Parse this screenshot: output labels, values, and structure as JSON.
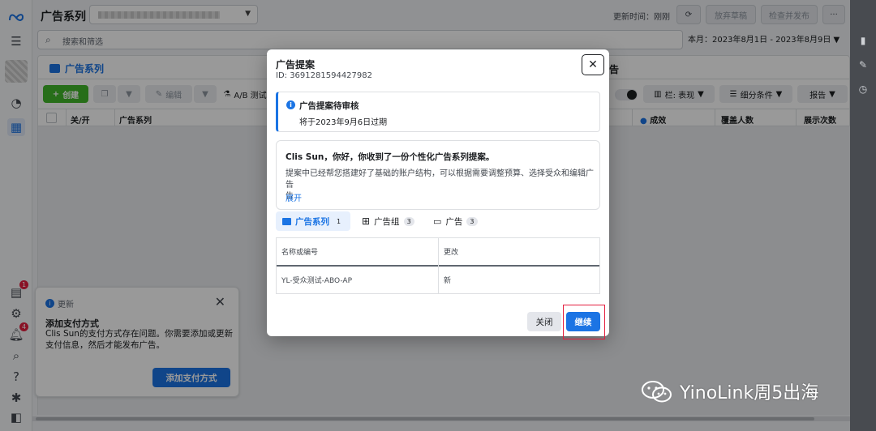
{
  "topbar": {
    "title": "广告系列",
    "updated": "更新时间：刚刚",
    "discard": "放弃草稿",
    "review_publish": "检查并发布",
    "more": "···"
  },
  "search": {
    "placeholder": "搜索和筛选"
  },
  "date_range": "本月：2023年8月1日 - 2023年8月9日",
  "tabs": {
    "campaigns": "广告系列",
    "ads_partial": "告"
  },
  "toolbar": {
    "create": "创建",
    "edit": "编辑",
    "ab_test": "A/B 测试",
    "columns": "栏: 表现",
    "breakdown": "细分条件",
    "reports": "报告"
  },
  "table": {
    "headers": [
      "关/开",
      "广告系列",
      "成效",
      "覆盖人数",
      "展示次数"
    ]
  },
  "rail": {
    "badge_campaigns": "1",
    "badge_notifications": "4"
  },
  "update_card": {
    "label": "更新",
    "title": "添加支付方式",
    "body": "Clis Sun的支付方式存在问题。你需要添加或更新支付信息，然后才能发布广告。",
    "button": "添加支付方式"
  },
  "modal": {
    "title": "广告提案",
    "id": "ID: 3691281594427982",
    "notice_title": "广告提案待审核",
    "notice_expiry": "将于2023年9月6日过期",
    "greeting": "Clis Sun，你好，你收到了一份个性化广告系列提案。",
    "description": "提案中已经帮您搭建好了基础的账户结构，可以根据需要调整预算、选择受众和编辑广告",
    "description_cont": "告",
    "expand": "展开",
    "tabs": [
      {
        "label": "广告系列",
        "count": "1"
      },
      {
        "label": "广告组",
        "count": "3"
      },
      {
        "label": "广告",
        "count": "3"
      }
    ],
    "table": {
      "col_name": "名称或编号",
      "col_change": "更改",
      "rows": [
        {
          "name": "YL-受众测试-ABO-AP",
          "change": "新"
        }
      ]
    },
    "close_button": "关闭",
    "continue_button": "继续"
  },
  "watermark": "YinoLink周5出海",
  "colors": {
    "accent": "#1b74e4",
    "create_green": "#42b72a",
    "highlight_red": "#e41e3f"
  }
}
